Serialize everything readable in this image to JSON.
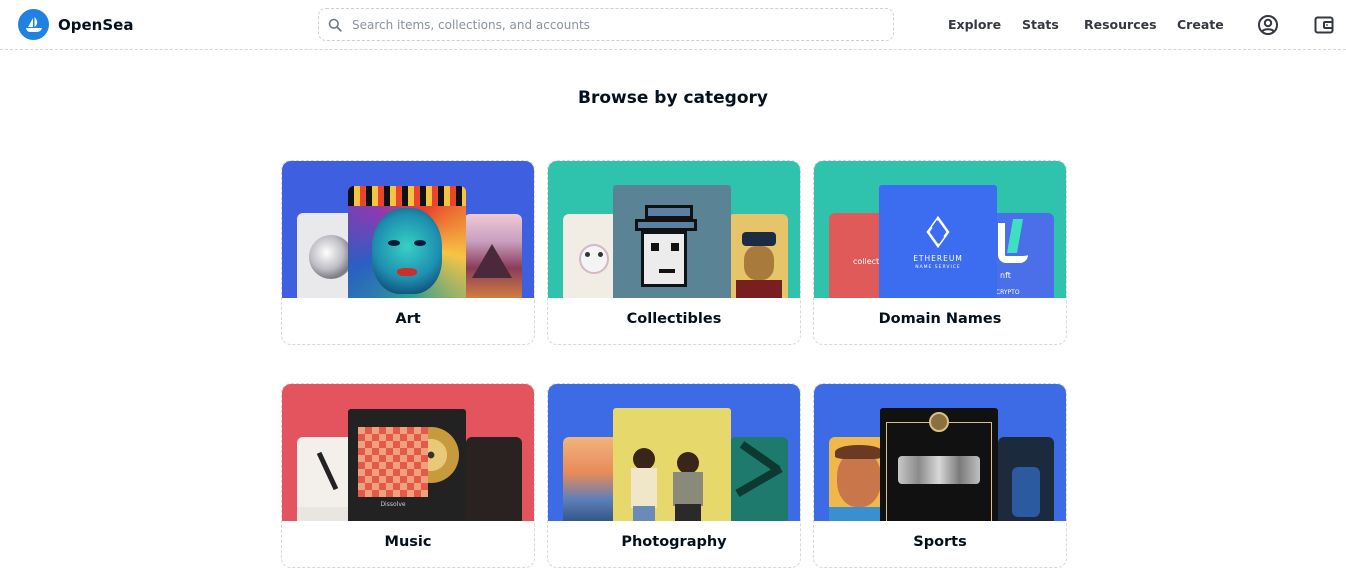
{
  "header": {
    "brand": "OpenSea",
    "search_placeholder": "Search items, collections, and accounts",
    "nav": [
      "Explore",
      "Stats",
      "Resources",
      "Create"
    ],
    "icons": [
      "account-icon",
      "wallet-icon"
    ],
    "brand_color": "#2081e2"
  },
  "main": {
    "title": "Browse by category",
    "categories": [
      {
        "label": "Art",
        "color": "#3d5fe0"
      },
      {
        "label": "Collectibles",
        "color": "#2fc3ad"
      },
      {
        "label": "Domain Names",
        "color": "#2fc3ad"
      },
      {
        "label": "Music",
        "color": "#e3545f"
      },
      {
        "label": "Photography",
        "color": "#3d6be6"
      },
      {
        "label": "Sports",
        "color": "#3d6be6"
      }
    ],
    "domain_card_text": {
      "collect": "collect",
      "ethereum": "ETHEREUM",
      "ens_sub": "NAME SERVICE",
      "nft": "nft",
      "crypto": ".CRYPTO"
    },
    "music_card_text": {
      "album": "Dissolve"
    }
  }
}
